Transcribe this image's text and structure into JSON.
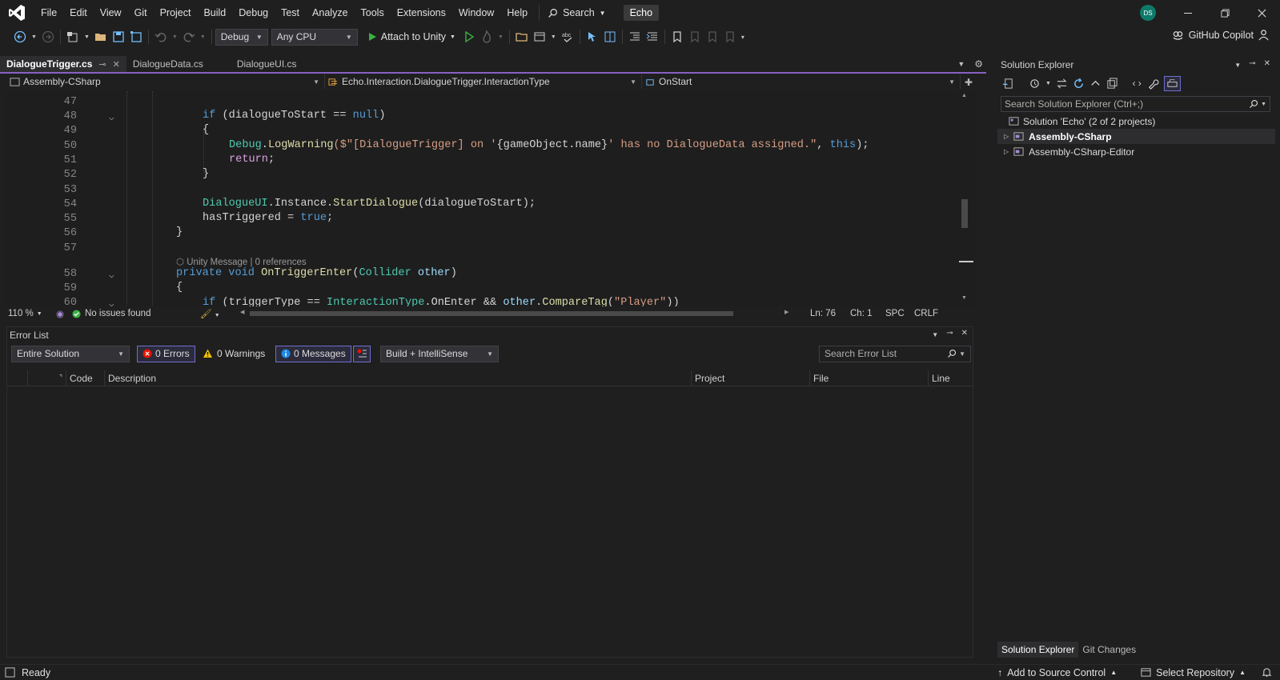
{
  "menu": [
    "File",
    "Edit",
    "View",
    "Git",
    "Project",
    "Build",
    "Debug",
    "Test",
    "Analyze",
    "Tools",
    "Extensions",
    "Window",
    "Help"
  ],
  "search_label": "Search",
  "solution_name": "Echo",
  "user_initials": "DS",
  "toolbar": {
    "config": "Debug",
    "platform": "Any CPU",
    "run_label": "Attach to Unity",
    "copilot_label": "GitHub Copilot"
  },
  "tabs": [
    {
      "label": "DialogueTrigger.cs"
    },
    {
      "label": "DialogueData.cs"
    },
    {
      "label": "DialogueUI.cs"
    }
  ],
  "navbar": {
    "project": "Assembly-CSharp",
    "type": "Echo.Interaction.DialogueTrigger.InteractionType",
    "member": "OnStart"
  },
  "editor": {
    "line_numbers": [
      "47",
      "48",
      "49",
      "50",
      "51",
      "52",
      "53",
      "54",
      "55",
      "56",
      "57",
      "58",
      "59",
      "60"
    ],
    "codelens": "Unity Message | 0 references",
    "zoom": "110 %",
    "issues": "No issues found",
    "ln": "Ln: 76",
    "ch": "Ch: 1",
    "spc": "SPC",
    "crlf": "CRLF"
  },
  "code_tokens": {
    "l48": [
      "if",
      "(dialogueToStart ==",
      "null",
      ")"
    ],
    "l49": "{",
    "l50": [
      "Debug",
      ".",
      "LogWarning",
      "($\"[DialogueTrigger] on '",
      "{gameObject.name}",
      "' has no DialogueData assigned.\"",
      ", ",
      "this",
      ");"
    ],
    "l51": [
      "return",
      ";"
    ],
    "l52": "}",
    "l54": [
      "DialogueUI",
      ".Instance.",
      "StartDialogue",
      "(dialogueToStart);"
    ],
    "l55": [
      "hasTriggered = ",
      "true",
      ";"
    ],
    "l56": "}",
    "l58": [
      "private",
      "void",
      "OnTriggerEnter",
      "(",
      "Collider",
      "other",
      ")"
    ],
    "l59": "{",
    "l60": [
      "if",
      "(triggerType ==",
      "InteractionType",
      ".OnEnter &&",
      "other",
      ".",
      "CompareTag",
      "(",
      "\"Player\"",
      "))"
    ]
  },
  "error_list": {
    "title": "Error List",
    "scope": "Entire Solution",
    "errors": "0 Errors",
    "warnings": "0 Warnings",
    "messages": "0 Messages",
    "build_filter": "Build + IntelliSense",
    "search_placeholder": "Search Error List",
    "columns": [
      "Code",
      "Description",
      "Project",
      "File",
      "Line"
    ]
  },
  "solution_explorer": {
    "title": "Solution Explorer",
    "search_placeholder": "Search Solution Explorer (Ctrl+;)",
    "solution": "Solution 'Echo' (2 of 2 projects)",
    "projects": [
      "Assembly-CSharp",
      "Assembly-CSharp-Editor"
    ],
    "bottom_tabs": [
      "Solution Explorer",
      "Git Changes"
    ]
  },
  "status": {
    "ready": "Ready",
    "source_control": "Add to Source Control",
    "repository": "Select Repository"
  }
}
